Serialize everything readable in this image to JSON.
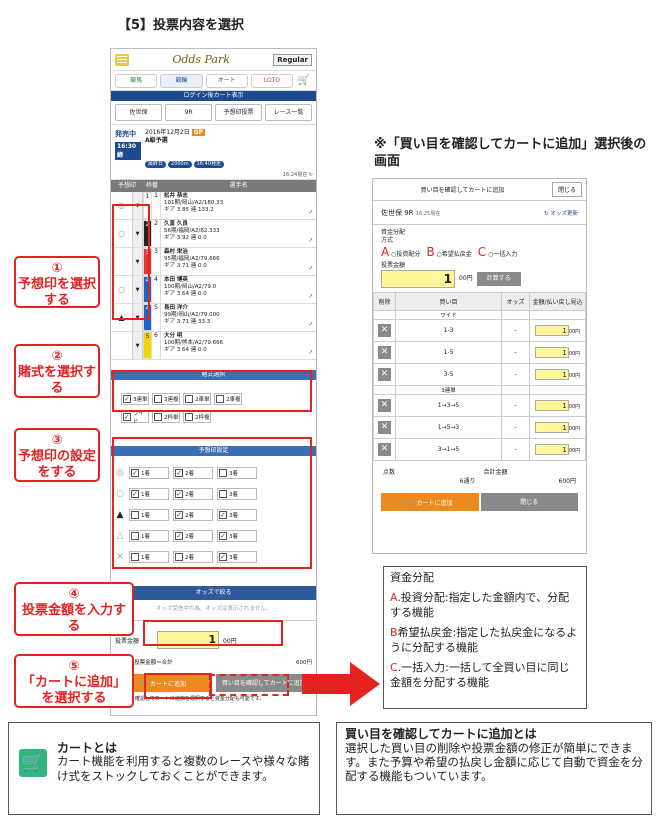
{
  "header": "【5】投票内容を選択",
  "phone": {
    "brand": "Odds Park",
    "regular": "Regular",
    "gnav": [
      "競馬",
      "競輪",
      "オート",
      "LOTO"
    ],
    "login_bar": "ログイン後カート表示",
    "race_btns": [
      "佐世保",
      "9R",
      "予想印投票",
      "レース一覧"
    ],
    "status": "発売中",
    "status_time": "16:30締",
    "date": "2016年12月2日",
    "grade": "GP",
    "race_name": "A級予選",
    "race_chips": [
      "最終日",
      "2000m",
      "16:40発走"
    ],
    "updated": "16:24現在",
    "th_mark": "予想印",
    "th_num": "枠番",
    "th_name": "選手名",
    "riders": [
      {
        "wak": "1",
        "num": "1",
        "name": "松井 恭志",
        "l1": "101期/岡山/A2/180.33",
        "l2": "ギア 3.85 連 133.2",
        "color": "#ffffff",
        "fg": "#222"
      },
      {
        "wak": "2",
        "num": "2",
        "name": "久富 久良",
        "l1": "56期/福岡/A2/82.333",
        "l2": "ギア 3.92 連 0.0",
        "color": "#222222",
        "fg": "#fff"
      },
      {
        "wak": "3",
        "num": "3",
        "name": "森村 栄治",
        "l1": "95期/福岡/A2/79.666",
        "l2": "ギア 3.71 連 0.0",
        "color": "#e53935",
        "fg": "#fff"
      },
      {
        "wak": "4",
        "num": "4",
        "name": "本田 博英",
        "l1": "100期/岡山/A2/79.0",
        "l2": "ギア 3.64 連 0.0",
        "color": "#1e63c8",
        "fg": "#fff"
      },
      {
        "wak": "4",
        "num": "5",
        "name": "長田 洋介",
        "l1": "99期/岡山/A2/79.000",
        "l2": "ギア 3.71 連 33.3",
        "color": "#1e63c8",
        "fg": "#fff"
      },
      {
        "wak": "5",
        "num": "6",
        "name": "大分 明",
        "l1": "100期/熊本/A2/79.666",
        "l2": "ギア 3.64 連 0.0",
        "color": "#f5d300",
        "fg": "#222"
      }
    ],
    "marks": [
      "◎",
      "○",
      "▲",
      "△",
      "×"
    ],
    "bet_type_header": "賭式選択",
    "bet_types": [
      "3連単",
      "3連複",
      "2車単",
      "2車複",
      "ワイド",
      "2枠単",
      "2枠複"
    ],
    "yoso_header": "予想印設定",
    "yoso_rows": [
      {
        "sym": "◎",
        "vals": [
          "1着",
          "2着",
          "3着"
        ]
      },
      {
        "sym": "○",
        "vals": [
          "1着",
          "2着",
          "3着"
        ]
      },
      {
        "sym": "▲",
        "vals": [
          "1着",
          "2着",
          "3着"
        ]
      },
      {
        "sym": "△",
        "vals": [
          "1着",
          "2着",
          "3着"
        ]
      },
      {
        "sym": "×",
        "vals": [
          "1着",
          "2着",
          "3着"
        ]
      }
    ],
    "odds_bar": "オッズで絞る",
    "odds_note": "オッズ受信中の為、オッズは表示されません。",
    "amount_label": "投票金額",
    "amount_value": "1",
    "amount_unit": "00円",
    "sum_left": "6通り×投票金額＝合計",
    "sum_right": "600円",
    "cart_btn": "カートに追加",
    "confirm_btn": "買い目を確認してカートに追加",
    "foot_note": "買い目を確認してカートに追加を選択すると資金分配も可能です。"
  },
  "callouts": [
    {
      "num": "①",
      "text": "予想印を選択する"
    },
    {
      "num": "②",
      "text": "賭式を選択する"
    },
    {
      "num": "③",
      "text": "予想印の設定をする"
    },
    {
      "num": "④",
      "text": "投票金額を入力する"
    },
    {
      "num": "⑤",
      "text": "「カートに追加」を選択する"
    }
  ],
  "right_title": "※「買い目を確認してカートに追加」選択後の画面",
  "cartscreen": {
    "title": "買い目を確認してカートに追加",
    "close": "閉じる",
    "race": "佐世保 9R",
    "time": "16:25現在",
    "refresh": "オッズ更新",
    "alloc_label": "資金分配方式",
    "opts": [
      {
        "letter": "A",
        "label": "投資配分"
      },
      {
        "letter": "B",
        "label": "希望払戻金"
      },
      {
        "letter": "C",
        "label": "一括入力"
      }
    ],
    "amount_label": "投票金額",
    "amount_value": "1",
    "amount_unit": "00円",
    "calc": "計算する",
    "cols": [
      "削除",
      "買い目",
      "オッズ",
      "金額/払い戻し見込"
    ],
    "group1": "ワイド",
    "rows1": [
      {
        "kaime": "1-3",
        "odds": "-",
        "amt": "1",
        "unit": "00円"
      },
      {
        "kaime": "1-5",
        "odds": "-",
        "amt": "1",
        "unit": "00円"
      },
      {
        "kaime": "3-5",
        "odds": "-",
        "amt": "1",
        "unit": "00円"
      }
    ],
    "group2": "3連単",
    "rows2": [
      {
        "kaime": "1→3→5",
        "odds": "-",
        "amt": "1",
        "unit": "00円"
      },
      {
        "kaime": "1→5→3",
        "odds": "-",
        "amt": "1",
        "unit": "00円"
      },
      {
        "kaime": "3→1→5",
        "odds": "-",
        "amt": "1",
        "unit": "00円"
      }
    ],
    "cnt_label": "点数",
    "cnt_value": "6通り",
    "total_label": "合計金額",
    "total_value": "600円",
    "add": "カートに追加",
    "close2": "閉じる"
  },
  "explain": {
    "title": "資金分配",
    "a": "A.投資分配:指定した金額内で、分配する機能",
    "b": "B希望払戻金:指定した払戻金になるように分配する機能",
    "c": "C.一括入力:一括して全買い目に同じ金額を分配する機能"
  },
  "box1": {
    "title": "カートとは",
    "body": "カート機能を利用すると複数のレースや様々な賭け式をストックしておくことができます。"
  },
  "box2": {
    "title": "買い目を確認してカートに追加とは",
    "body": "選択した買い目の削除や投票金額の修正が簡単にできます。また予算や希望の払戻し金額に応じて自動で資金を分配する機能もついています。"
  },
  "colors": {
    "accent_red": "#e52222",
    "navy": "#1d4b8f",
    "orange": "#ec8a1f",
    "yellow_input": "#fff799",
    "cart_icon": "#2eb67d"
  }
}
